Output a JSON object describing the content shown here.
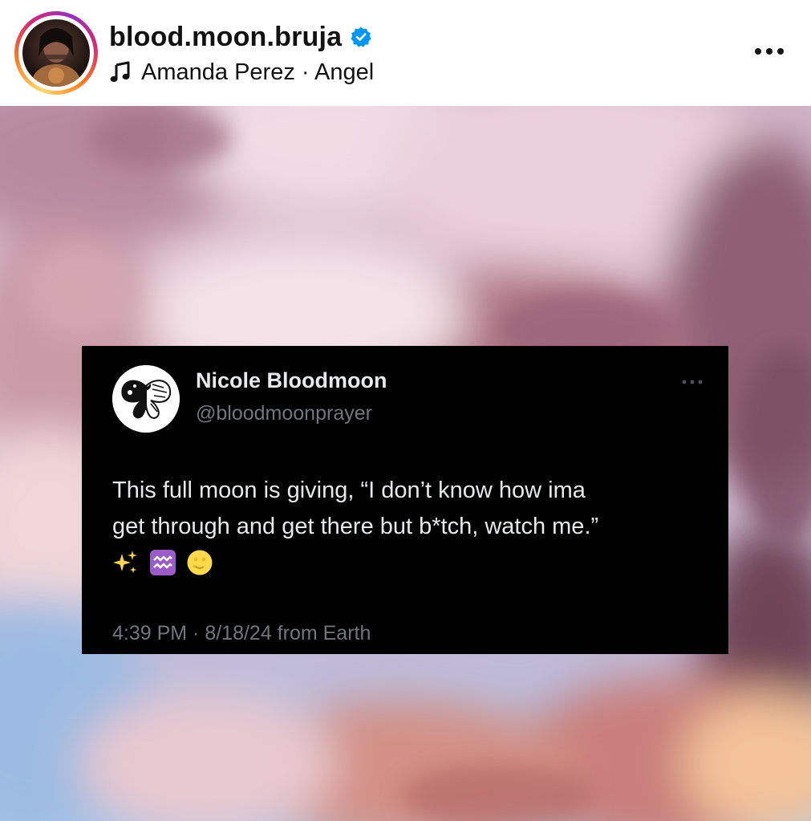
{
  "header": {
    "username": "blood.moon.bruja",
    "verified": true,
    "audio": "Amanda Perez · Angel",
    "icons": {
      "verified": "verified-badge-icon",
      "music": "music-note-icon",
      "more": "more-options-icon"
    }
  },
  "tweet": {
    "display_name": "Nicole Bloodmoon",
    "handle": "@bloodmoonprayer",
    "text_lines": [
      "This full moon is giving, “I don’t know how ima",
      "get through and get there but b*tch, watch me.”"
    ],
    "emojis": [
      "sparkles",
      "aquarius",
      "full-moon-face"
    ],
    "meta": "4:39 PM · 8/18/24 from Earth"
  },
  "colors": {
    "tweet_bg": "#000000",
    "tweet_text": "#e7e9ea",
    "tweet_secondary": "#71767b",
    "verified_blue": "#0095f6",
    "sky_pink": "#d99aa6",
    "sky_blue": "#a9c6e8"
  }
}
